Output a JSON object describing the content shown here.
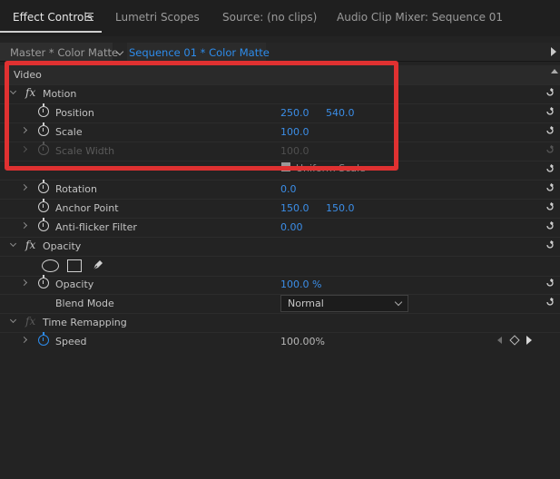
{
  "tabs": [
    {
      "label": "Effect Controls"
    },
    {
      "label": "Lumetri Scopes"
    },
    {
      "label": "Source: (no clips)"
    },
    {
      "label": "Audio Clip Mixer: Sequence 01"
    }
  ],
  "clip": {
    "master": "Master * Color Matte",
    "sequence": "Sequence 01 * Color Matte"
  },
  "section": {
    "video": "Video"
  },
  "motion": {
    "label": "Motion",
    "position": {
      "label": "Position",
      "x": "250.0",
      "y": "540.0"
    },
    "scale": {
      "label": "Scale",
      "value": "100.0"
    },
    "scale_width": {
      "label": "Scale Width",
      "value": "100.0"
    },
    "uniform_scale": {
      "label": "Uniform Scale"
    },
    "rotation": {
      "label": "Rotation",
      "value": "0.0"
    },
    "anchor_point": {
      "label": "Anchor Point",
      "x": "150.0",
      "y": "150.0"
    },
    "anti_flicker": {
      "label": "Anti-flicker Filter",
      "value": "0.00"
    }
  },
  "opacity": {
    "label": "Opacity",
    "opacity_prop": {
      "label": "Opacity",
      "value": "100.0 %"
    },
    "blend_mode": {
      "label": "Blend Mode",
      "value": "Normal"
    }
  },
  "time_remapping": {
    "label": "Time Remapping",
    "speed": {
      "label": "Speed",
      "value": "100.00%"
    }
  },
  "colors": {
    "accent": "#2d8ceb",
    "highlight": "#e03131"
  },
  "icons": [
    "hamburger-menu-icon",
    "stopwatch-icon",
    "reset-icon",
    "fx-icon",
    "ellipse-mask-icon",
    "rectangle-mask-icon",
    "pen-mask-icon"
  ]
}
